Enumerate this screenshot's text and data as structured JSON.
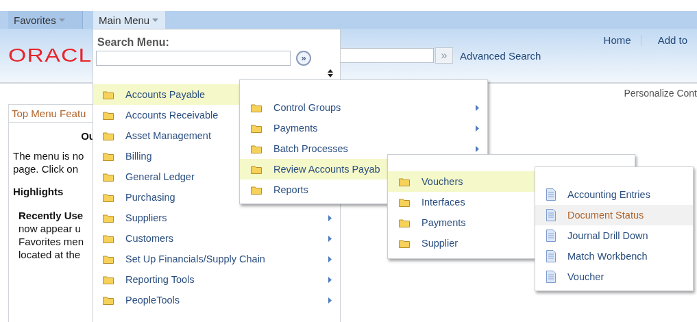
{
  "nav_tabs": [
    {
      "label": "Favorites",
      "selected": false
    },
    {
      "label": "Main Menu",
      "selected": true
    }
  ],
  "header": {
    "logo": "ORACL",
    "search_button": "»",
    "advanced_search": "Advanced Search",
    "links": [
      "Home",
      "Add to"
    ]
  },
  "personalize": "Personalize Cont",
  "pagelet": {
    "title": "Top Menu Featu",
    "heading": "Ou",
    "text_lines": [
      "The menu is no",
      "page. Click on"
    ],
    "subheading": "Highlights",
    "bold_line": "Recently Use",
    "lines": [
      "now appear u",
      "Favorites men",
      "located at the"
    ]
  },
  "search_menu": {
    "title": "Search Menu:",
    "go_button": "»"
  },
  "menus": [
    {
      "kind": "folders",
      "items": [
        {
          "label": "Accounts Payable",
          "selected": true,
          "submenu": false
        },
        {
          "label": "Accounts Receivable",
          "selected": false,
          "submenu": false
        },
        {
          "label": "Asset Management",
          "selected": false,
          "submenu": false
        },
        {
          "label": "Billing",
          "selected": false,
          "submenu": false
        },
        {
          "label": "General Ledger",
          "selected": false,
          "submenu": false
        },
        {
          "label": "Purchasing",
          "selected": false,
          "submenu": false
        },
        {
          "label": "Suppliers",
          "selected": false,
          "submenu": true
        },
        {
          "label": "Customers",
          "selected": false,
          "submenu": true
        },
        {
          "label": "Set Up Financials/Supply Chain",
          "selected": false,
          "submenu": true
        },
        {
          "label": "Reporting Tools",
          "selected": false,
          "submenu": true
        },
        {
          "label": "PeopleTools",
          "selected": false,
          "submenu": true
        }
      ]
    },
    {
      "kind": "folders",
      "items": [
        {
          "label": "Control Groups",
          "selected": false,
          "submenu": true
        },
        {
          "label": "Payments",
          "selected": false,
          "submenu": true
        },
        {
          "label": "Batch Processes",
          "selected": false,
          "submenu": true
        },
        {
          "label": "Review Accounts Payab",
          "selected": true,
          "submenu": false
        },
        {
          "label": "Reports",
          "selected": false,
          "submenu": false
        }
      ]
    },
    {
      "kind": "folders",
      "items": [
        {
          "label": "Vouchers",
          "selected": true,
          "submenu": false
        },
        {
          "label": "Interfaces",
          "selected": false,
          "submenu": false
        },
        {
          "label": "Payments",
          "selected": false,
          "submenu": false
        },
        {
          "label": "Supplier",
          "selected": false,
          "submenu": false
        }
      ]
    },
    {
      "kind": "pages",
      "items": [
        {
          "label": "Accounting Entries",
          "selected": false,
          "submenu": false
        },
        {
          "label": "Document Status",
          "selected": true,
          "submenu": false
        },
        {
          "label": "Journal Drill Down",
          "selected": false,
          "submenu": false
        },
        {
          "label": "Match Workbench",
          "selected": false,
          "submenu": false
        },
        {
          "label": "Voucher",
          "selected": false,
          "submenu": false
        }
      ]
    }
  ]
}
